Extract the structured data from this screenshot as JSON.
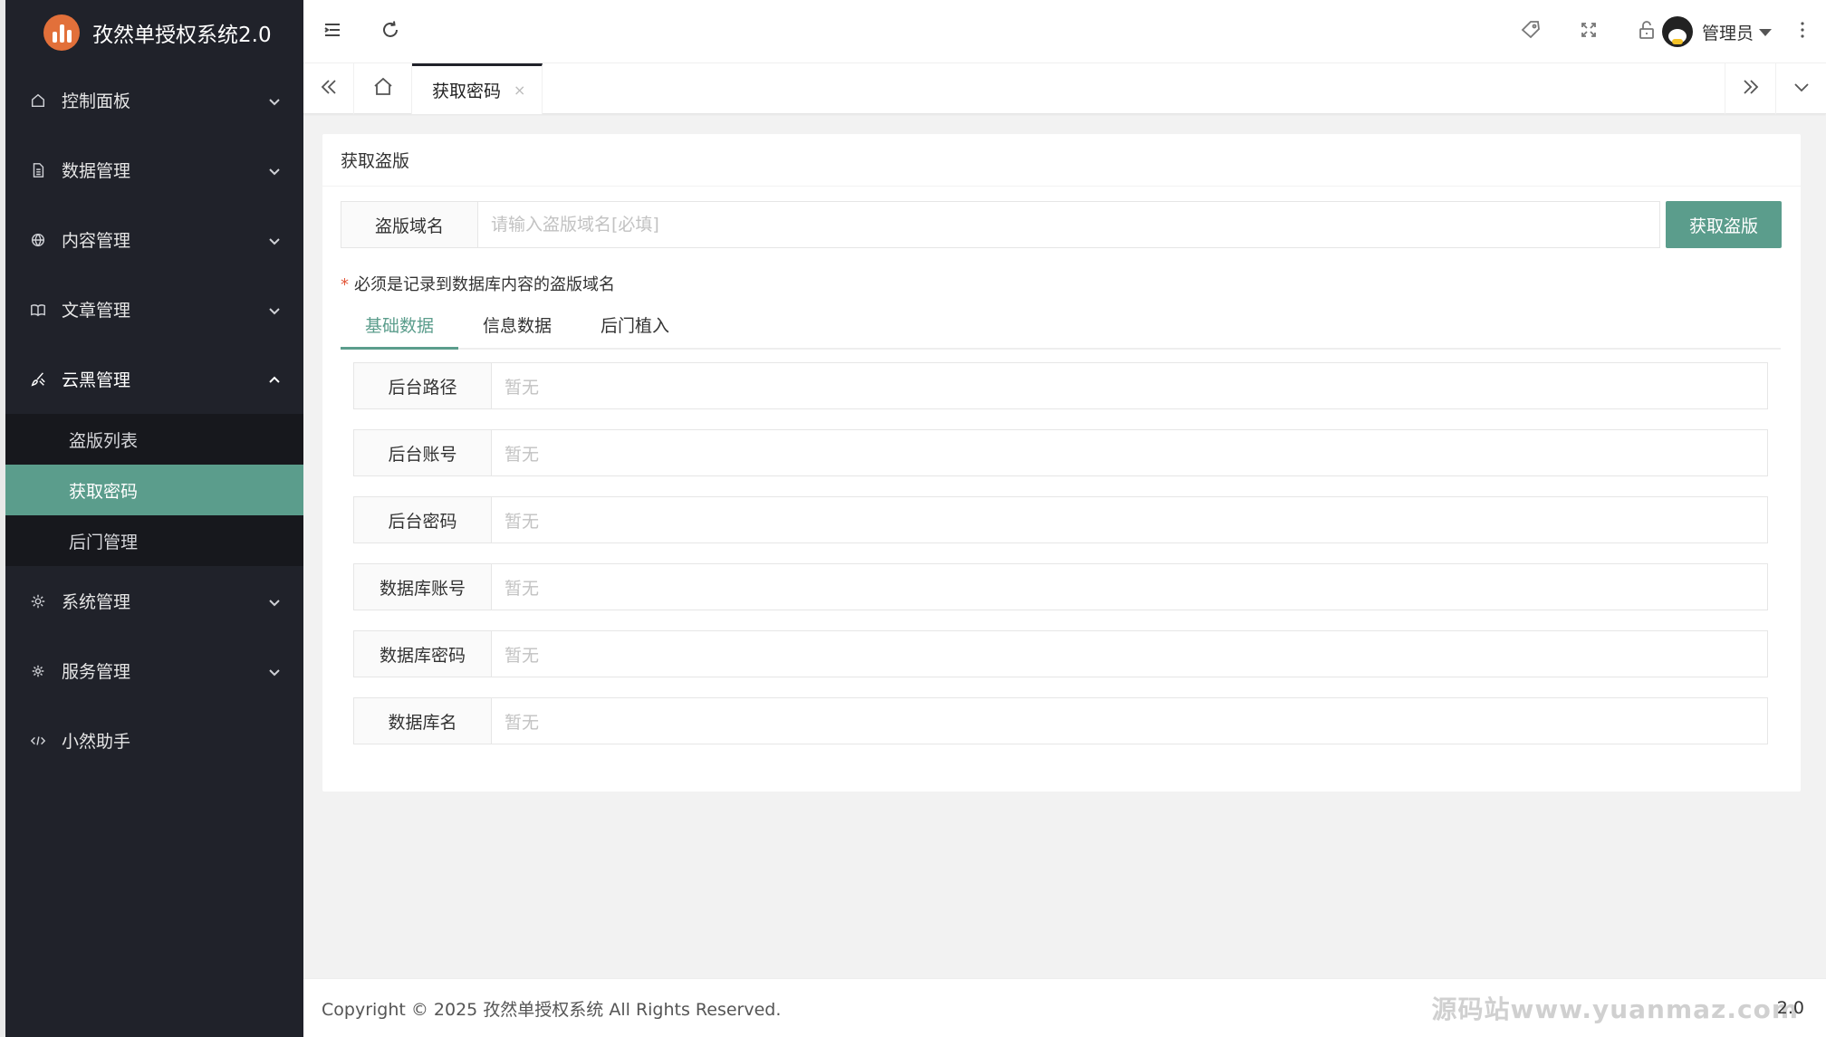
{
  "app": {
    "title": "孜然单授权系统2.0"
  },
  "sidebar": {
    "items": [
      {
        "label": "控制面板",
        "icon": "home-icon"
      },
      {
        "label": "数据管理",
        "icon": "document-icon"
      },
      {
        "label": "内容管理",
        "icon": "globe-icon"
      },
      {
        "label": "文章管理",
        "icon": "book-icon"
      },
      {
        "label": "云黑管理",
        "icon": "brush-icon",
        "expanded": true,
        "children": [
          {
            "label": "盗版列表"
          },
          {
            "label": "获取密码",
            "active": true
          },
          {
            "label": "后门管理"
          }
        ]
      },
      {
        "label": "系统管理",
        "icon": "gear-icon"
      },
      {
        "label": "服务管理",
        "icon": "service-icon"
      },
      {
        "label": "小然助手",
        "icon": "code-icon"
      }
    ]
  },
  "header": {
    "user_name": "管理员"
  },
  "tabbar": {
    "active_tab": "获取密码",
    "close_glyph": "×"
  },
  "card": {
    "title": "获取盗版",
    "search": {
      "label": "盗版域名",
      "placeholder": "请输入盗版域名[必填]",
      "value": "",
      "button": "获取盗版"
    },
    "hint_star": "*",
    "hint": "必须是记录到数据库内容的盗版域名",
    "tabs": [
      {
        "label": "基础数据",
        "active": true
      },
      {
        "label": "信息数据"
      },
      {
        "label": "后门植入"
      }
    ],
    "fields": [
      {
        "label": "后台路径",
        "value": "暂无"
      },
      {
        "label": "后台账号",
        "value": "暂无"
      },
      {
        "label": "后台密码",
        "value": "暂无"
      },
      {
        "label": "数据库账号",
        "value": "暂无"
      },
      {
        "label": "数据库密码",
        "value": "暂无"
      },
      {
        "label": "数据库名",
        "value": "暂无"
      }
    ]
  },
  "footer": {
    "copyright": "Copyright © 2025 孜然单授权系统 All Rights Reserved.",
    "version": "2.0",
    "watermark": "源码站www.yuanmaz.com"
  },
  "colors": {
    "accent": "#5b9d8c",
    "sidebar_bg": "#20222a",
    "sub_bg": "#17181d"
  }
}
